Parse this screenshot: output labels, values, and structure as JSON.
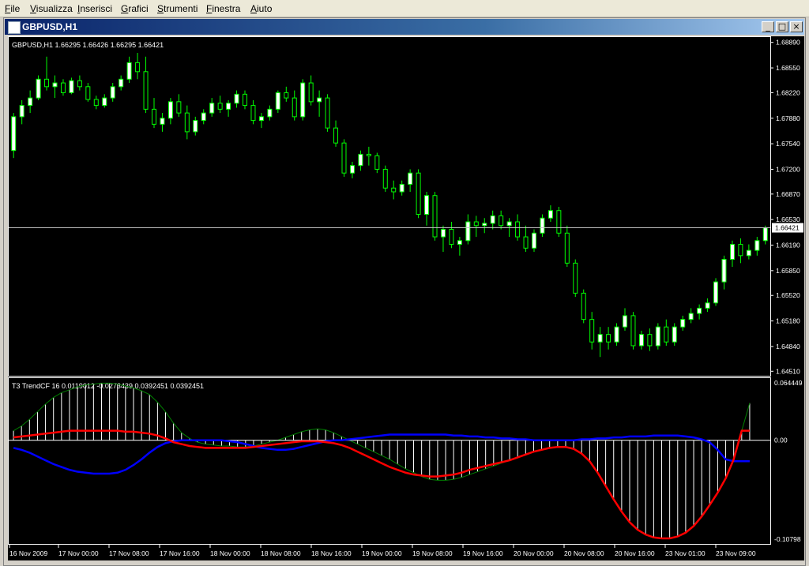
{
  "menu": [
    "File",
    "Visualizza",
    "Inserisci",
    "Grafici",
    "Strumenti",
    "Finestra",
    "Aiuto"
  ],
  "window": {
    "title": "GBPUSD,H1",
    "buttons": [
      "minimize",
      "maximize",
      "close"
    ]
  },
  "header_text": "GBPUSD,H1  1.66295 1.66426 1.66295 1.66421",
  "price_axis": [
    "1.68890",
    "1.68550",
    "1.68220",
    "1.67880",
    "1.67540",
    "1.67200",
    "1.66870",
    "1.66530",
    "1.66190",
    "1.65850",
    "1.65520",
    "1.65180",
    "1.64840",
    "1.64510"
  ],
  "current_price": "1.66421",
  "indicator": {
    "label": "T3 TrendCF 16 0.0119012 -0.0273439 0.0392451 0.0392451",
    "axis": [
      "0.064449",
      "0.00",
      "-0.10798"
    ]
  },
  "time_axis": [
    "16 Nov 2009",
    "17 Nov 00:00",
    "17 Nov 08:00",
    "17 Nov 16:00",
    "18 Nov 00:00",
    "18 Nov 08:00",
    "18 Nov 16:00",
    "19 Nov 00:00",
    "19 Nov 08:00",
    "19 Nov 16:00",
    "20 Nov 00:00",
    "20 Nov 08:00",
    "20 Nov 16:00",
    "23 Nov 01:00",
    "23 Nov 09:00"
  ],
  "colors": {
    "background": "#000000",
    "bull_candle": "#ffffff",
    "wick": "#00ff00",
    "price_line": "#c0c0c0",
    "red_line": "#ff0000",
    "blue_line": "#0000ff",
    "green_line": "#008000",
    "histogram": "#ffffff",
    "axis_text": "#ffffff"
  },
  "chart_data": {
    "type": "candlestick",
    "symbol": "GBPUSD",
    "timeframe": "H1",
    "ylim": [
      1.6445,
      1.6895
    ],
    "candles": [
      [
        1.6745,
        1.6795,
        1.6735,
        1.679
      ],
      [
        1.679,
        1.6812,
        1.678,
        1.6805
      ],
      [
        1.6805,
        1.6825,
        1.6795,
        1.6815
      ],
      [
        1.6815,
        1.6845,
        1.6812,
        1.684
      ],
      [
        1.684,
        1.687,
        1.6825,
        1.683
      ],
      [
        1.683,
        1.6845,
        1.6815,
        1.6835
      ],
      [
        1.6835,
        1.684,
        1.6818,
        1.6822
      ],
      [
        1.6822,
        1.6842,
        1.682,
        1.6838
      ],
      [
        1.6838,
        1.6845,
        1.6825,
        1.683
      ],
      [
        1.683,
        1.6835,
        1.681,
        1.6813
      ],
      [
        1.6813,
        1.6818,
        1.68,
        1.6805
      ],
      [
        1.6805,
        1.682,
        1.6802,
        1.6815
      ],
      [
        1.6815,
        1.6835,
        1.681,
        1.683
      ],
      [
        1.683,
        1.6845,
        1.6825,
        1.684
      ],
      [
        1.684,
        1.687,
        1.6835,
        1.6862
      ],
      [
        1.6862,
        1.6875,
        1.684,
        1.685
      ],
      [
        1.685,
        1.687,
        1.6795,
        1.68
      ],
      [
        1.68,
        1.6815,
        1.6775,
        1.678
      ],
      [
        1.678,
        1.6795,
        1.677,
        1.6788
      ],
      [
        1.6788,
        1.6815,
        1.678,
        1.681
      ],
      [
        1.681,
        1.682,
        1.679,
        1.6795
      ],
      [
        1.6795,
        1.6805,
        1.676,
        1.677
      ],
      [
        1.677,
        1.679,
        1.6765,
        1.6785
      ],
      [
        1.6785,
        1.68,
        1.678,
        1.6795
      ],
      [
        1.6795,
        1.6815,
        1.679,
        1.6808
      ],
      [
        1.6808,
        1.6818,
        1.6795,
        1.68
      ],
      [
        1.68,
        1.6812,
        1.679,
        1.6808
      ],
      [
        1.6808,
        1.6825,
        1.6802,
        1.682
      ],
      [
        1.682,
        1.6825,
        1.68,
        1.6805
      ],
      [
        1.6805,
        1.6812,
        1.678,
        1.6785
      ],
      [
        1.6785,
        1.6795,
        1.6775,
        1.679
      ],
      [
        1.679,
        1.6805,
        1.6785,
        1.68
      ],
      [
        1.68,
        1.6825,
        1.6795,
        1.6822
      ],
      [
        1.6822,
        1.683,
        1.681,
        1.6815
      ],
      [
        1.6815,
        1.6825,
        1.6785,
        1.679
      ],
      [
        1.679,
        1.684,
        1.6785,
        1.6835
      ],
      [
        1.6835,
        1.6845,
        1.6805,
        1.681
      ],
      [
        1.681,
        1.6825,
        1.679,
        1.6815
      ],
      [
        1.6815,
        1.682,
        1.677,
        1.6775
      ],
      [
        1.6775,
        1.6785,
        1.675,
        1.6755
      ],
      [
        1.6755,
        1.676,
        1.671,
        1.6715
      ],
      [
        1.6715,
        1.673,
        1.6708,
        1.6725
      ],
      [
        1.6725,
        1.6745,
        1.6718,
        1.674
      ],
      [
        1.674,
        1.675,
        1.6725,
        1.6738
      ],
      [
        1.6738,
        1.6742,
        1.6715,
        1.672
      ],
      [
        1.672,
        1.6725,
        1.669,
        1.6695
      ],
      [
        1.6695,
        1.6705,
        1.668,
        1.669
      ],
      [
        1.669,
        1.6705,
        1.6685,
        1.67
      ],
      [
        1.67,
        1.672,
        1.669,
        1.6715
      ],
      [
        1.6715,
        1.672,
        1.6655,
        1.666
      ],
      [
        1.666,
        1.669,
        1.6645,
        1.6685
      ],
      [
        1.6685,
        1.669,
        1.6625,
        1.663
      ],
      [
        1.663,
        1.6645,
        1.661,
        1.664
      ],
      [
        1.664,
        1.665,
        1.6615,
        1.662
      ],
      [
        1.662,
        1.663,
        1.6605,
        1.6625
      ],
      [
        1.6625,
        1.666,
        1.662,
        1.665
      ],
      [
        1.665,
        1.6658,
        1.663,
        1.6645
      ],
      [
        1.6645,
        1.6655,
        1.6635,
        1.6648
      ],
      [
        1.6648,
        1.6665,
        1.664,
        1.6658
      ],
      [
        1.6658,
        1.6665,
        1.664,
        1.6645
      ],
      [
        1.6645,
        1.6655,
        1.663,
        1.665
      ],
      [
        1.665,
        1.666,
        1.6625,
        1.663
      ],
      [
        1.663,
        1.6645,
        1.661,
        1.6615
      ],
      [
        1.6615,
        1.664,
        1.661,
        1.6635
      ],
      [
        1.6635,
        1.666,
        1.663,
        1.6655
      ],
      [
        1.6655,
        1.6672,
        1.665,
        1.6665
      ],
      [
        1.6665,
        1.667,
        1.663,
        1.6635
      ],
      [
        1.6635,
        1.6645,
        1.659,
        1.6595
      ],
      [
        1.6595,
        1.66,
        1.655,
        1.6555
      ],
      [
        1.6555,
        1.656,
        1.6515,
        1.652
      ],
      [
        1.652,
        1.653,
        1.648,
        1.649
      ],
      [
        1.649,
        1.651,
        1.647,
        1.65
      ],
      [
        1.65,
        1.651,
        1.648,
        1.649
      ],
      [
        1.649,
        1.6515,
        1.6485,
        1.651
      ],
      [
        1.651,
        1.6535,
        1.6505,
        1.6525
      ],
      [
        1.6525,
        1.653,
        1.648,
        1.6485
      ],
      [
        1.6485,
        1.6505,
        1.648,
        1.65
      ],
      [
        1.65,
        1.6508,
        1.6478,
        1.6485
      ],
      [
        1.6485,
        1.6515,
        1.648,
        1.651
      ],
      [
        1.651,
        1.652,
        1.6485,
        1.649
      ],
      [
        1.649,
        1.6515,
        1.6485,
        1.651
      ],
      [
        1.651,
        1.6525,
        1.6505,
        1.652
      ],
      [
        1.652,
        1.6535,
        1.6515,
        1.6528
      ],
      [
        1.6528,
        1.654,
        1.652,
        1.6535
      ],
      [
        1.6535,
        1.6548,
        1.653,
        1.6542
      ],
      [
        1.6542,
        1.6575,
        1.6538,
        1.657
      ],
      [
        1.657,
        1.6605,
        1.656,
        1.66
      ],
      [
        1.66,
        1.6625,
        1.659,
        1.662
      ],
      [
        1.662,
        1.6628,
        1.6595,
        1.6605
      ],
      [
        1.6605,
        1.662,
        1.66,
        1.6612
      ],
      [
        1.6612,
        1.663,
        1.6605,
        1.6625
      ],
      [
        1.6625,
        1.6645,
        1.662,
        1.6642
      ]
    ],
    "indicator_series": {
      "ylim": [
        -0.10798,
        0.064449
      ],
      "histogram": [
        0.01,
        0.015,
        0.022,
        0.03,
        0.038,
        0.045,
        0.05,
        0.053,
        0.056,
        0.058,
        0.059,
        0.06,
        0.06,
        0.059,
        0.057,
        0.055,
        0.052,
        0.048,
        0.04,
        0.03,
        0.018,
        0.008,
        0.002,
        -0.002,
        -0.004,
        -0.005,
        -0.006,
        -0.006,
        -0.007,
        -0.007,
        -0.006,
        -0.004,
        -0.002,
        0.0,
        0.003,
        0.006,
        0.009,
        0.011,
        0.012,
        0.011,
        0.008,
        0.004,
        0.0,
        -0.004,
        -0.008,
        -0.012,
        -0.016,
        -0.02,
        -0.025,
        -0.03,
        -0.034,
        -0.038,
        -0.041,
        -0.042,
        -0.042,
        -0.041,
        -0.039,
        -0.036,
        -0.033,
        -0.03,
        -0.027,
        -0.024,
        -0.021,
        -0.018,
        -0.015,
        -0.012,
        -0.01,
        -0.008,
        -0.007,
        -0.007,
        -0.009,
        -0.014,
        -0.022,
        -0.034,
        -0.048,
        -0.062,
        -0.075,
        -0.086,
        -0.094,
        -0.099,
        -0.102,
        -0.103,
        -0.103,
        -0.101,
        -0.097,
        -0.09,
        -0.08,
        -0.068,
        -0.055,
        -0.04,
        -0.02,
        0.01,
        0.039
      ],
      "red": [
        0.003,
        0.004,
        0.005,
        0.006,
        0.007,
        0.008,
        0.009,
        0.01,
        0.01,
        0.01,
        0.01,
        0.01,
        0.01,
        0.01,
        0.009,
        0.009,
        0.008,
        0.007,
        0.005,
        0.002,
        -0.002,
        -0.004,
        -0.006,
        -0.007,
        -0.008,
        -0.008,
        -0.008,
        -0.008,
        -0.008,
        -0.008,
        -0.007,
        -0.006,
        -0.005,
        -0.004,
        -0.003,
        -0.002,
        -0.001,
        -0.001,
        -0.001,
        -0.002,
        -0.003,
        -0.005,
        -0.008,
        -0.012,
        -0.016,
        -0.02,
        -0.024,
        -0.028,
        -0.031,
        -0.034,
        -0.036,
        -0.037,
        -0.038,
        -0.038,
        -0.037,
        -0.036,
        -0.034,
        -0.031,
        -0.029,
        -0.027,
        -0.025,
        -0.023,
        -0.021,
        -0.018,
        -0.015,
        -0.012,
        -0.01,
        -0.008,
        -0.007,
        -0.007,
        -0.009,
        -0.014,
        -0.022,
        -0.034,
        -0.048,
        -0.062,
        -0.075,
        -0.086,
        -0.094,
        -0.099,
        -0.102,
        -0.103,
        -0.103,
        -0.101,
        -0.097,
        -0.09,
        -0.08,
        -0.068,
        -0.055,
        -0.04,
        -0.02,
        0.01,
        0.01
      ],
      "blue": [
        -0.008,
        -0.01,
        -0.013,
        -0.017,
        -0.021,
        -0.025,
        -0.028,
        -0.031,
        -0.033,
        -0.034,
        -0.035,
        -0.035,
        -0.035,
        -0.034,
        -0.031,
        -0.026,
        -0.02,
        -0.013,
        -0.007,
        -0.003,
        -0.001,
        0.0,
        0.0,
        0.0,
        0.0,
        0.0,
        0.0,
        -0.001,
        -0.002,
        -0.004,
        -0.006,
        -0.008,
        -0.009,
        -0.01,
        -0.01,
        -0.009,
        -0.007,
        -0.005,
        -0.003,
        -0.001,
        0.0,
        0.0,
        0.001,
        0.002,
        0.003,
        0.004,
        0.005,
        0.006,
        0.006,
        0.006,
        0.006,
        0.006,
        0.006,
        0.006,
        0.006,
        0.005,
        0.005,
        0.004,
        0.004,
        0.003,
        0.003,
        0.002,
        0.002,
        0.001,
        0.001,
        0.0,
        0.0,
        0.0,
        0.0,
        0.0,
        0.0,
        0.001,
        0.001,
        0.002,
        0.002,
        0.003,
        0.003,
        0.004,
        0.004,
        0.004,
        0.005,
        0.005,
        0.005,
        0.005,
        0.004,
        0.003,
        0.001,
        -0.002,
        -0.01,
        -0.02,
        -0.022,
        -0.022,
        -0.022
      ]
    }
  }
}
